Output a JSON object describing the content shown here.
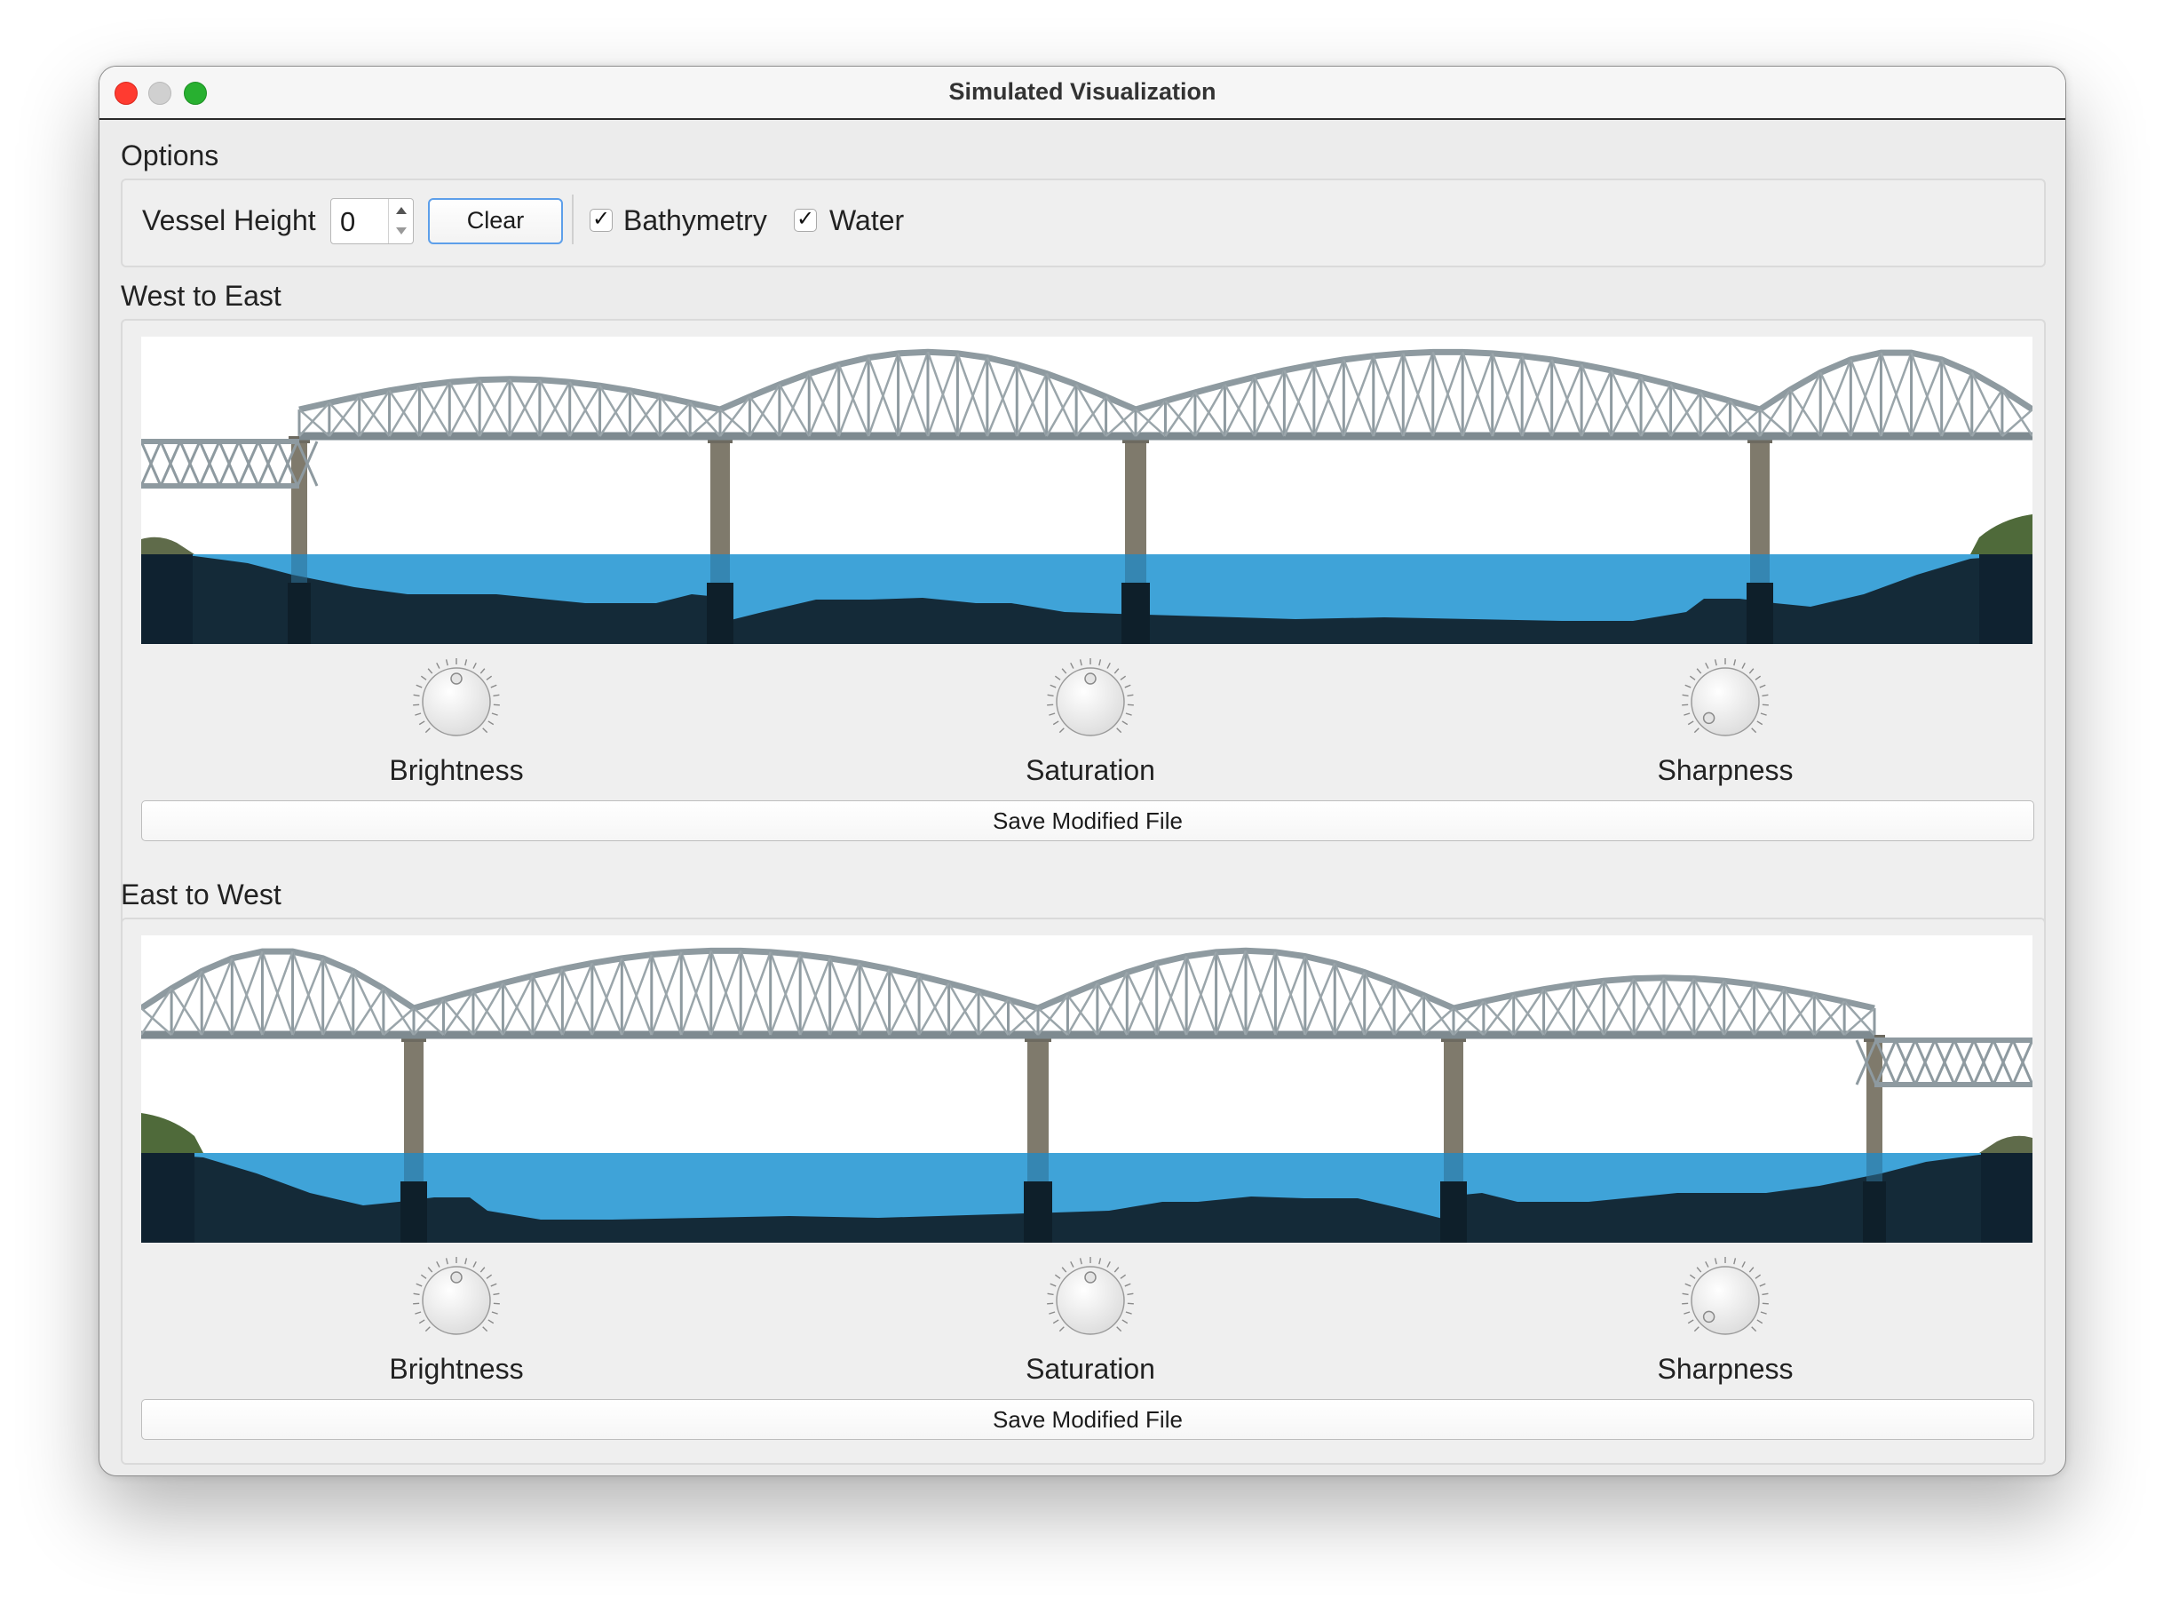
{
  "window": {
    "title": "Simulated Visualization"
  },
  "options": {
    "title": "Options",
    "vessel_height_label": "Vessel Height",
    "vessel_height_value": "0",
    "clear_label": "Clear",
    "bathymetry": {
      "label": "Bathymetry",
      "checked": true,
      "mark": "✓"
    },
    "water": {
      "label": "Water",
      "checked": true,
      "mark": "✓"
    }
  },
  "panels": [
    {
      "title": "West to East",
      "image": "bridge-profile-west-to-east",
      "dials": [
        {
          "label": "Brightness",
          "level": 0.5
        },
        {
          "label": "Saturation",
          "level": 0.5
        },
        {
          "label": "Sharpness",
          "level": 0.0
        }
      ],
      "save_label": "Save Modified File"
    },
    {
      "title": "East to West",
      "image": "bridge-profile-east-to-west",
      "dials": [
        {
          "label": "Brightness",
          "level": 0.5
        },
        {
          "label": "Saturation",
          "level": 0.5
        },
        {
          "label": "Sharpness",
          "level": 0.0
        }
      ],
      "save_label": "Save Modified File"
    }
  ],
  "colors": {
    "water": "#3fa3d8",
    "bathymetry": "#142a38",
    "steel": "#8e9aa0",
    "pier": "#7f7a6c",
    "close": "#ff3b30",
    "maximize": "#28b030",
    "focus_ring": "#5d9fea"
  }
}
